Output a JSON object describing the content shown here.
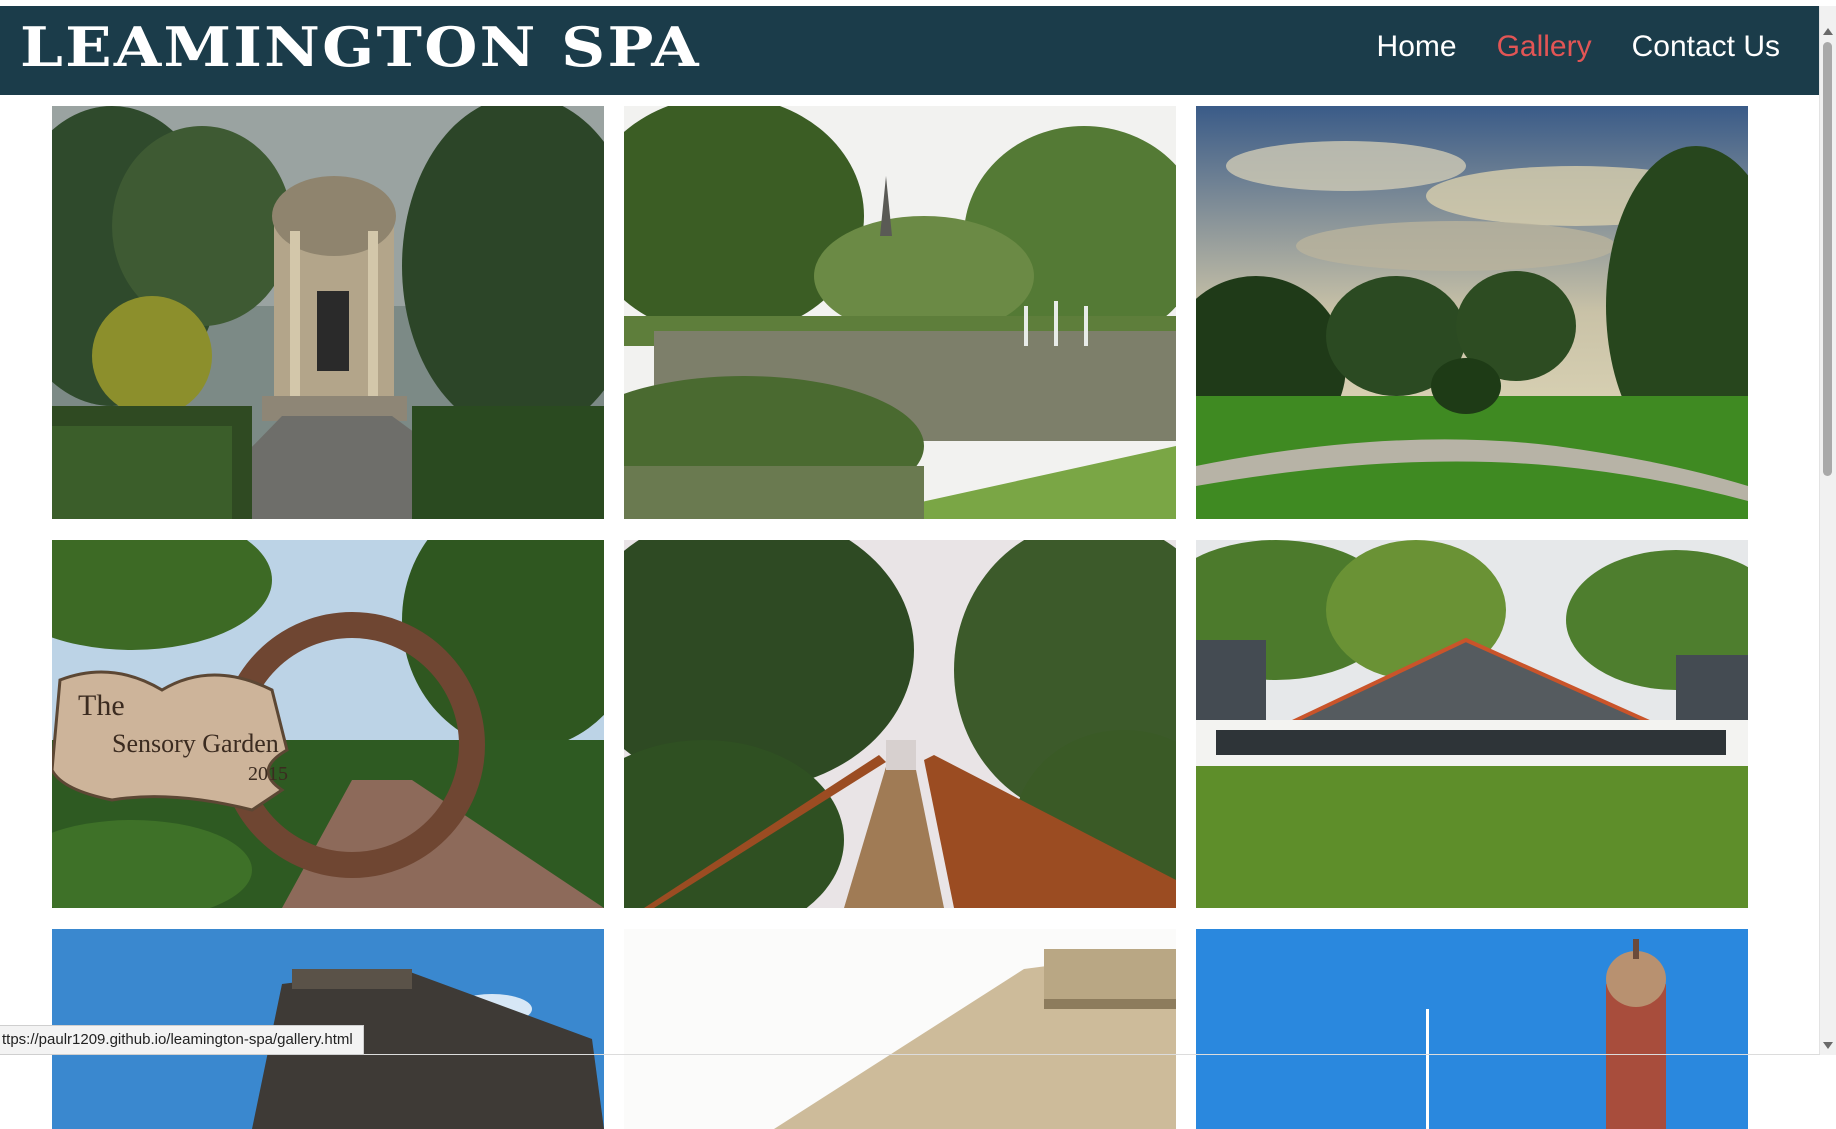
{
  "header": {
    "title": "LEAMINGTON SPA",
    "nav": [
      {
        "label": "Home",
        "active": false
      },
      {
        "label": "Gallery",
        "active": true
      },
      {
        "label": "Contact Us",
        "active": false
      }
    ]
  },
  "gallery": {
    "sensory_sign": {
      "line1": "The",
      "line2": "Sensory Garden",
      "line3": "2015"
    }
  },
  "status_url": "ttps://paulr1209.github.io/leamington-spa/gallery.html",
  "colors": {
    "header_bg": "#1b3c4a",
    "nav_text": "#ffffff",
    "nav_active": "#e25555"
  }
}
